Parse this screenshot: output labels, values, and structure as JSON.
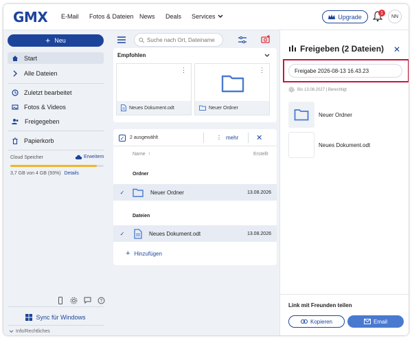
{
  "brand": "GMX",
  "nav": {
    "links": [
      "E-Mail",
      "Fotos & Dateien",
      "News",
      "Deals",
      "Services"
    ],
    "upgrade_label": "Upgrade",
    "notifications_count": "1",
    "avatar_initials": "NN"
  },
  "sidebar": {
    "new_label": "Neu",
    "items": [
      {
        "label": "Start",
        "icon": "home-icon"
      },
      {
        "label": "Alle Dateien",
        "icon": "chevron-right-icon"
      },
      {
        "label": "Zuletzt bearbeitet",
        "icon": "clock-icon"
      },
      {
        "label": "Fotos & Videos",
        "icon": "image-icon"
      },
      {
        "label": "Freigegeben",
        "icon": "people-icon"
      },
      {
        "label": "Papierkorb",
        "icon": "trash-icon"
      }
    ],
    "cloud_label": "Cloud Speicher",
    "cloud_extend": "Erweitern",
    "cloud_usage": "3,7 GB von 4 GB (93%)",
    "cloud_usage_percent": 93,
    "cloud_details": "Details",
    "sync_label": "Sync für Windows",
    "info_label": "Info/Rechtliches"
  },
  "main": {
    "search_placeholder": "Suche nach Ort, Dateiname",
    "recommended_title": "Empfohlen",
    "recommended": [
      {
        "name": "Neues Dokument.odt",
        "type": "doc"
      },
      {
        "name": "Neuer Ordner",
        "type": "folder"
      }
    ],
    "selected_count": "2 ausgewählt",
    "more_label": "mehr",
    "col_name": "Name",
    "col_created": "Erstellt",
    "group_folders": "Ordner",
    "group_files": "Dateien",
    "rows": [
      {
        "name": "Neuer Ordner",
        "date": "13.08.2026"
      },
      {
        "name": "Neues Dokument.odt",
        "date": "13.08.2026"
      }
    ],
    "add_label": "Hinzufügen"
  },
  "share": {
    "title": "Freigeben (2 Dateien)",
    "name_value": "Freigabe 2026-08-13 16.43.23",
    "meta_text": "Bis 13.08.2027 | Berechtigt",
    "files": [
      "Neuer Ordner",
      "Neues Dokument.odt"
    ],
    "friends_title": "Link mit Freunden teilen",
    "copy_label": "Kopieren",
    "email_label": "Email"
  },
  "colors": {
    "brand_blue": "#1c449b",
    "highlight_red": "#c8143b",
    "storage_yellow": "#f0b625"
  }
}
